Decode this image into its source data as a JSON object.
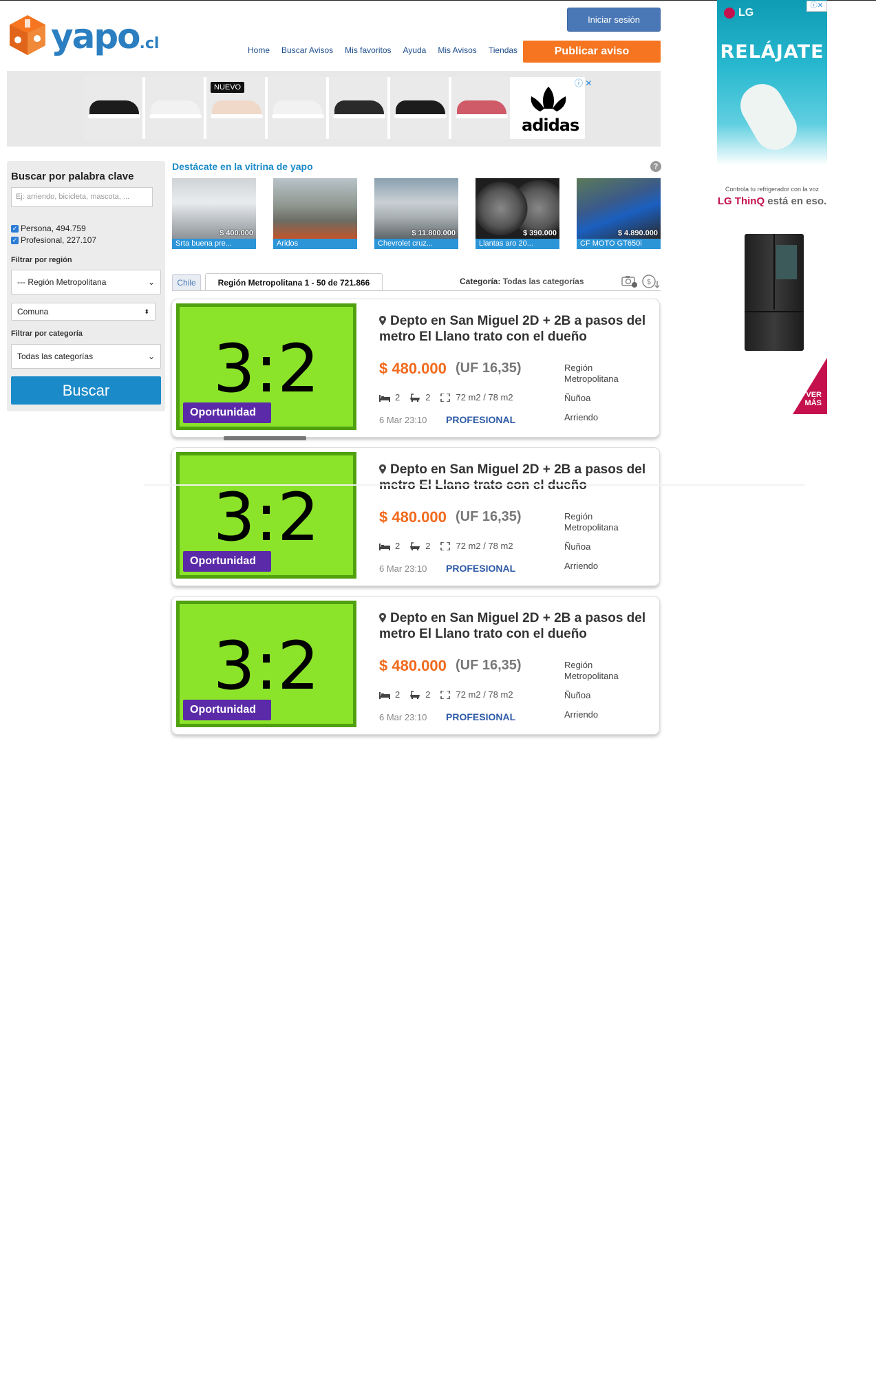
{
  "header": {
    "logo_text": "yapo",
    "logo_suffix": ".cl",
    "login_label": "Iniciar sesión",
    "nav": [
      "Home",
      "Buscar Avisos",
      "Mis favoritos",
      "Ayuda",
      "Mis Avisos",
      "Tiendas"
    ],
    "publish_label": "Publicar aviso"
  },
  "ad_banner": {
    "badge": "NUEVO",
    "brand": "adidas",
    "shoe_colors": [
      "#1c1c1c",
      "#f2f2f2",
      "#f0d9c9",
      "#f2f2f2",
      "#2a2a2a",
      "#1c1c1c",
      "#cf5a68"
    ]
  },
  "sidebar": {
    "title": "Buscar por palabra clave",
    "search_placeholder": "Ej: arriendo, bicicleta, mascota, ...",
    "filters": [
      {
        "label": "Persona, 494.759",
        "checked": true
      },
      {
        "label": "Profesional, 227.107",
        "checked": true
      }
    ],
    "region_label": "Filtrar por región",
    "region_value": "--- Región Metropolitana",
    "comuna_value": "Comuna",
    "category_label": "Filtrar por categoría",
    "category_value": "Todas las categorías",
    "search_button": "Buscar"
  },
  "vitrina": {
    "title": "Destácate en la vitrina de yapo",
    "help": "?",
    "items": [
      {
        "price": "$ 400.000",
        "caption": "Srta buena pre..."
      },
      {
        "price": "",
        "caption": "Aridos"
      },
      {
        "price": "$ 11.800.000",
        "caption": "Chevrolet cruz..."
      },
      {
        "price": "$ 390.000",
        "caption": "Llantas aro 20..."
      },
      {
        "price": "$ 4.890.000",
        "caption": "CF MOTO GT650i"
      }
    ]
  },
  "tabs": {
    "chile": "Chile",
    "region": "Región Metropolitana 1 - 50 de 721.866",
    "category_prefix": "Categoría:",
    "category_value": "Todas las categorías"
  },
  "listings": [
    {
      "image_text": "3:2",
      "badge": "Oportunidad",
      "title": "Depto en San Miguel 2D + 2B a pasos del metro El Llano trato con el dueño",
      "price": "$ 480.000",
      "uf": "(UF 16,35)",
      "region": "Región Metropolitana",
      "bedrooms": "2",
      "bathrooms": "2",
      "area": "72 m2 / 78 m2",
      "comuna": "Ñuñoa",
      "date": "6 Mar 23:10",
      "seller": "PROFESIONAL",
      "type": "Arriendo"
    },
    {
      "image_text": "3:2",
      "badge": "Oportunidad",
      "title": "Depto en San Miguel 2D + 2B a pasos del metro El Llano trato con el dueño",
      "price": "$ 480.000",
      "uf": "(UF 16,35)",
      "region": "Región Metropolitana",
      "bedrooms": "2",
      "bathrooms": "2",
      "area": "72 m2 / 78 m2",
      "comuna": "Ñuñoa",
      "date": "6 Mar 23:10",
      "seller": "PROFESIONAL",
      "type": "Arriendo"
    },
    {
      "image_text": "3:2",
      "badge": "Oportunidad",
      "title": "Depto en San Miguel 2D + 2B a pasos del metro El Llano trato con el dueño",
      "price": "$ 480.000",
      "uf": "(UF 16,35)",
      "region": "Región Metropolitana",
      "bedrooms": "2",
      "bathrooms": "2",
      "area": "72 m2 / 78 m2",
      "comuna": "Ñuñoa",
      "date": "6 Mar 23:10",
      "seller": "PROFESIONAL",
      "type": "Arriendo"
    }
  ],
  "right_ad": {
    "brand": "LG",
    "headline": "RELÁJATE",
    "subtext": "Controla tu refrigerador con la voz",
    "tagline_brand": "LG ThinQ",
    "tagline_rest": " está en eso.",
    "cta": "VER MÁS",
    "chip": "ⓘ✕"
  }
}
